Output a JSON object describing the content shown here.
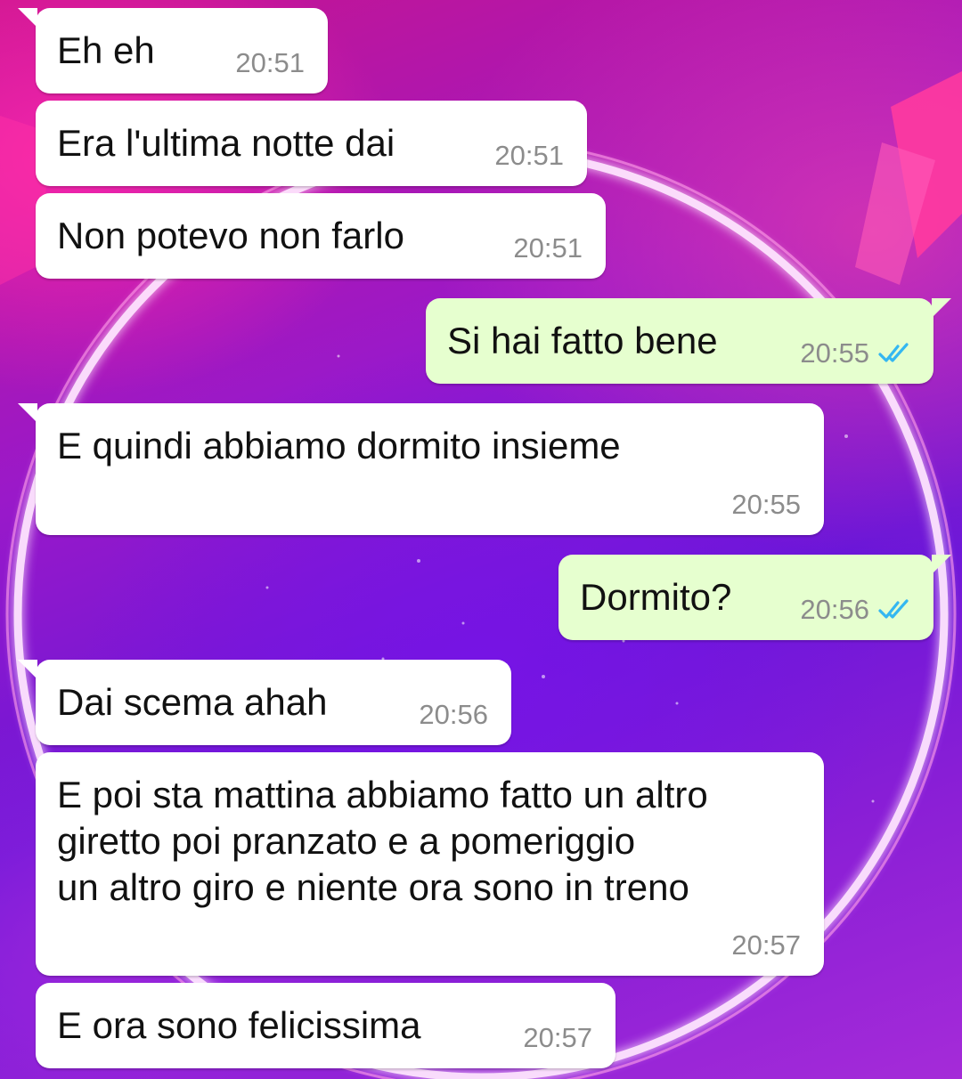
{
  "colors": {
    "incoming_bubble": "#ffffff",
    "outgoing_bubble": "#e6ffcf",
    "timestamp": "#8c8c8c",
    "read_ticks": "#34b7f1"
  },
  "messages": [
    {
      "direction": "in",
      "text": "Eh eh",
      "time": "20:51"
    },
    {
      "direction": "in",
      "text": "Era l'ultima notte dai",
      "time": "20:51"
    },
    {
      "direction": "in",
      "text": "Non potevo non farlo",
      "time": "20:51"
    },
    {
      "direction": "out",
      "text": "Si hai fatto bene",
      "time": "20:55",
      "status": "read-double-check-icon"
    },
    {
      "direction": "in",
      "text": "E quindi abbiamo dormito insieme",
      "time": "20:55"
    },
    {
      "direction": "out",
      "text": "Dormito?",
      "time": "20:56",
      "status": "read-double-check-icon"
    },
    {
      "direction": "in",
      "text": "Dai scema ahah",
      "time": "20:56"
    },
    {
      "direction": "in",
      "text": "E poi sta mattina abbiamo fatto un altro\ngiretto poi pranzato e a pomeriggio\nun altro giro e niente ora sono in treno",
      "time": "20:57"
    },
    {
      "direction": "in",
      "text": "E ora sono felicissima",
      "time": "20:57"
    }
  ]
}
